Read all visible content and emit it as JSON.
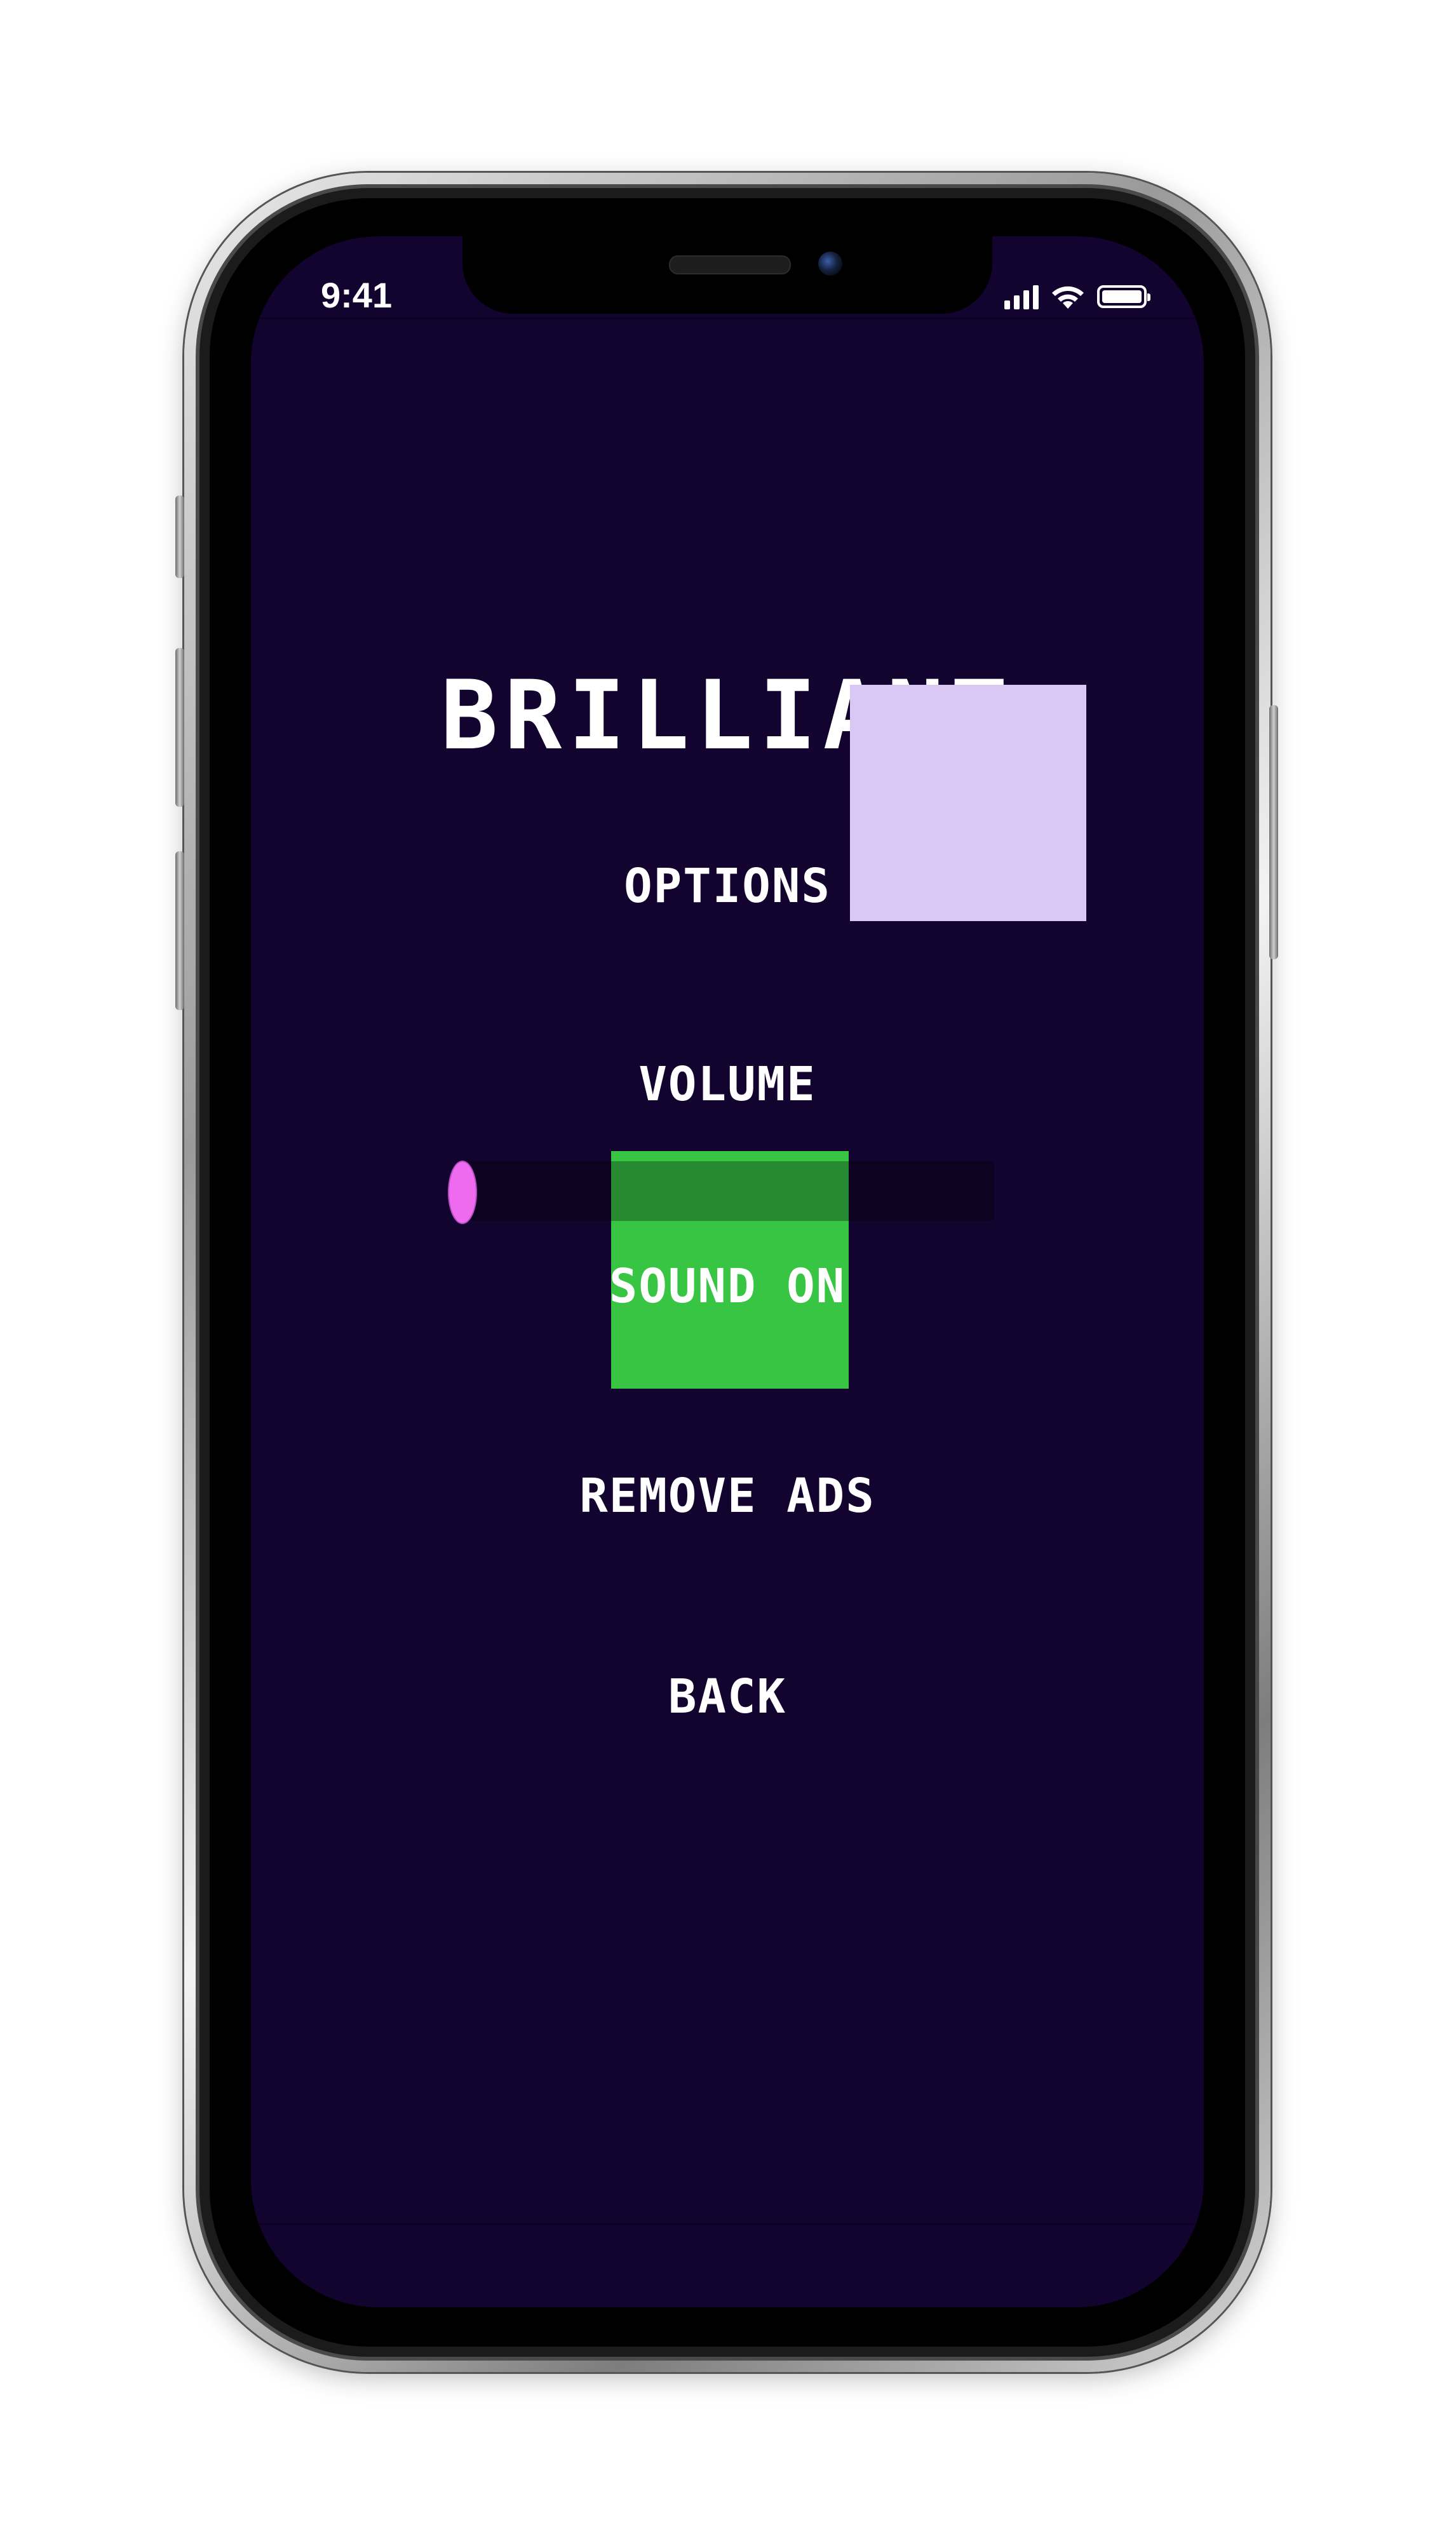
{
  "status_bar": {
    "time": "9:41",
    "signal_icon": "cellular-signal-icon",
    "wifi_icon": "wifi-icon",
    "battery_icon": "battery-icon"
  },
  "game": {
    "title": "BRILLIANT",
    "section_title": "OPTIONS",
    "volume_label": "VOLUME",
    "volume_level": 0,
    "sound_toggle_label": "SOUND ON",
    "remove_ads_label": "REMOVE ADS",
    "back_label": "BACK"
  },
  "colors": {
    "background": "#12032f",
    "text": "#ffffff",
    "title_overlay_box": "#d8c8f3",
    "sound_box": "#39c544",
    "sound_box_dark": "#278a33",
    "slider_knob": "#ee6bf0",
    "slider_track": "#0d0220"
  }
}
